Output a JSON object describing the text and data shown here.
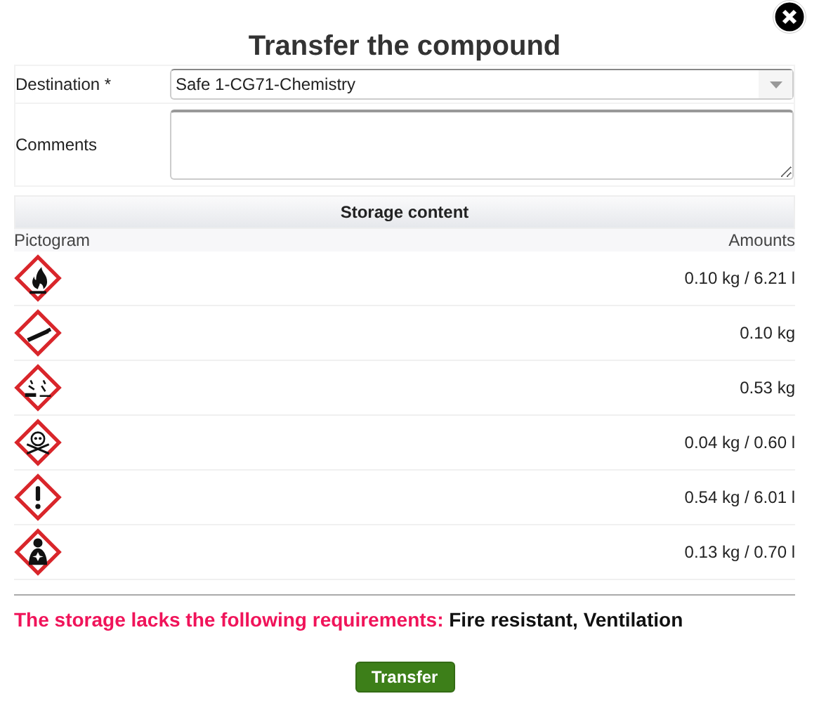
{
  "dialog": {
    "title": "Transfer the compound"
  },
  "form": {
    "destination": {
      "label": "Destination *",
      "value": "Safe 1-CG71-Chemistry"
    },
    "comments": {
      "label": "Comments"
    }
  },
  "storage": {
    "title": "Storage content",
    "columns": [
      "Pictogram",
      "Amounts"
    ],
    "rows": [
      {
        "kind": "flame",
        "amount": "0.10 kg / 6.21 l"
      },
      {
        "kind": "gas",
        "amount": "0.10 kg"
      },
      {
        "kind": "corrosion",
        "amount": "0.53 kg"
      },
      {
        "kind": "skull",
        "amount": "0.04 kg / 0.60 l"
      },
      {
        "kind": "exclamation",
        "amount": "0.54 kg / 6.01 l"
      },
      {
        "kind": "health",
        "amount": "0.13 kg / 0.70 l"
      }
    ]
  },
  "warning": {
    "label": "The storage lacks the following requirements:",
    "requirements": "Fire resistant, Ventilation"
  },
  "buttons": [
    "Transfer"
  ]
}
